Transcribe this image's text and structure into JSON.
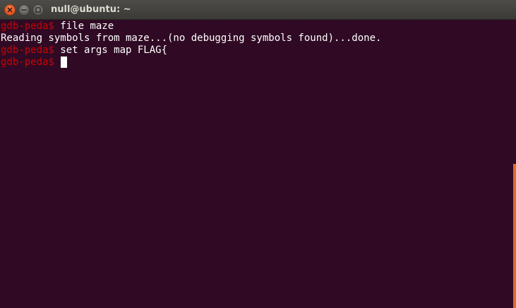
{
  "window": {
    "title": "null@ubuntu: ~"
  },
  "terminal": {
    "lines": [
      {
        "prompt": "gdb-peda$",
        "text": " file maze"
      },
      {
        "prompt": "",
        "text": "Reading symbols from maze...(no debugging symbols found)...done."
      },
      {
        "prompt": "gdb-peda$",
        "text": " set args map FLAG{"
      },
      {
        "prompt": "gdb-peda$",
        "text": " "
      }
    ]
  },
  "colors": {
    "background": "#300a24",
    "prompt": "#cc0000",
    "text": "#ffffff",
    "scrollbar": "#e06b2a"
  },
  "icons": {
    "close": "close-icon",
    "minimize": "minimize-icon",
    "maximize": "maximize-icon"
  }
}
